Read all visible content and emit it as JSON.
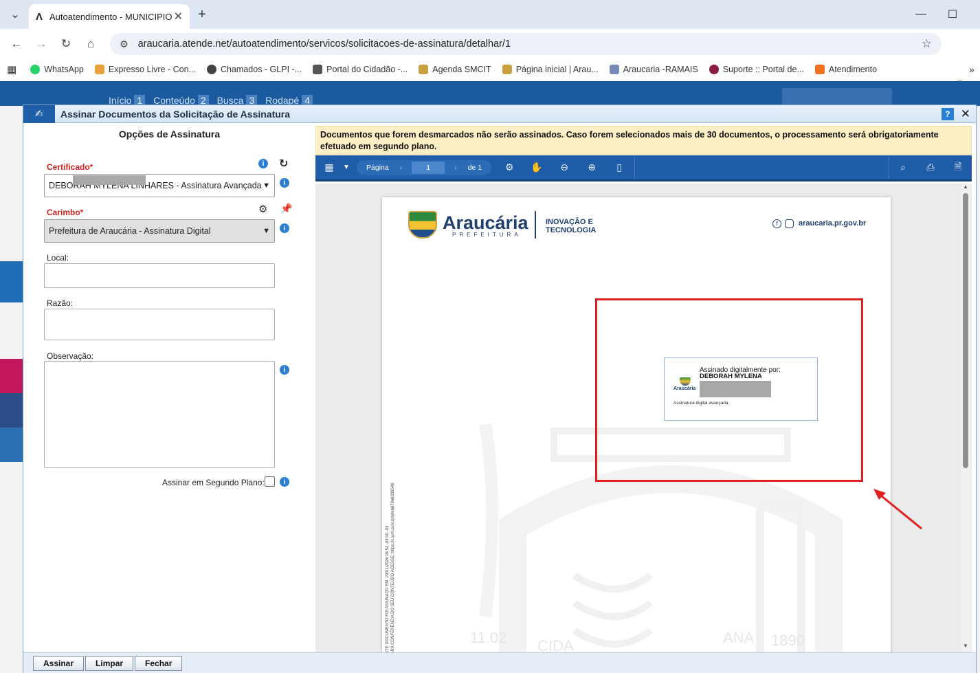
{
  "browser": {
    "tab_title": "Autoatendimento - MUNICIPIO",
    "url": "araucaria.atende.net/autoatendimento/servicos/solicitacoes-de-assinatura/detalhar/1",
    "bookmarks": [
      {
        "label": "WhatsApp",
        "color": "#25d366"
      },
      {
        "label": "Expresso Livre - Con...",
        "color": "#e9a23b"
      },
      {
        "label": "Chamados - GLPI -...",
        "color": "#333333"
      },
      {
        "label": "Portal do Cidadão -...",
        "color": "#333333"
      },
      {
        "label": "Agenda SMCIT",
        "color": "#c8a040"
      },
      {
        "label": "Página inicial | Arau...",
        "color": "#c8a040"
      },
      {
        "label": "Araucaria -RAMAIS",
        "color": "#7a8ab8"
      },
      {
        "label": "Suporte :: Portal de...",
        "color": "#8b1e3f"
      },
      {
        "label": "Atendimento",
        "color": "#f07020"
      }
    ]
  },
  "site": {
    "skip_links": [
      {
        "label": "Início",
        "key": "1"
      },
      {
        "label": "Conteúdo",
        "key": "2"
      },
      {
        "label": "Busca",
        "key": "3"
      },
      {
        "label": "Rodapé",
        "key": "4"
      }
    ]
  },
  "modal": {
    "title": "Assinar Documentos da Solicitação de Assinatura",
    "help": "?",
    "left": {
      "heading": "Opções de Assinatura",
      "certificado_label": "Certificado*",
      "certificado_value": "DEBORAH MYLENA LINHARES - Assinatura Avançada - valid",
      "carimbo_label": "Carimbo*",
      "carimbo_value": "Prefeitura de Araucária - Assinatura Digital",
      "local_label": "Local:",
      "razao_label": "Razão:",
      "observacao_label": "Observação:",
      "segundo_plano_label": "Assinar em Segundo Plano:"
    },
    "notice": "Documentos que forem desmarcados não serão assinados. Caso forem selecionados mais de 30 documentos, o processamento será obrigatoriamente efetuado em segundo plano.",
    "viewer": {
      "page_label": "Página",
      "page_number": "1",
      "page_total": "de 1"
    },
    "document": {
      "brand": "Araucária",
      "brand_sub": "PREFEITURA",
      "dept_line1": "INOVAÇÃO E",
      "dept_line2": "TECNOLOGIA",
      "site": "araucaria.pr.gov.br",
      "signature_title": "Assinado digitalmente por:",
      "signature_name": "DEBORAH MYLENA LINHARES",
      "signature_type": "Assinatura digital avançada.",
      "stamp_logo": "Araucária",
      "side_text_1": "ESTE DOCUMENTO FOI ASSINADO EM: 23/01/2026 06:52 -03:00 -03",
      "side_text_2": "PARA CONFERÊNCIA DO SEU CONTEÚDO ACESSE: https://c.ipm.com.br/pfeb679a6339549",
      "watermark_left": "11.02",
      "watermark_right": "1890",
      "watermark_mid": "CIDA",
      "watermark_mid2": "ANA"
    },
    "footer": {
      "assinar": "Assinar",
      "limpar": "Limpar",
      "fechar": "Fechar"
    }
  },
  "colors": {
    "accent": "#1f5da8",
    "highlight": "#e02020"
  }
}
